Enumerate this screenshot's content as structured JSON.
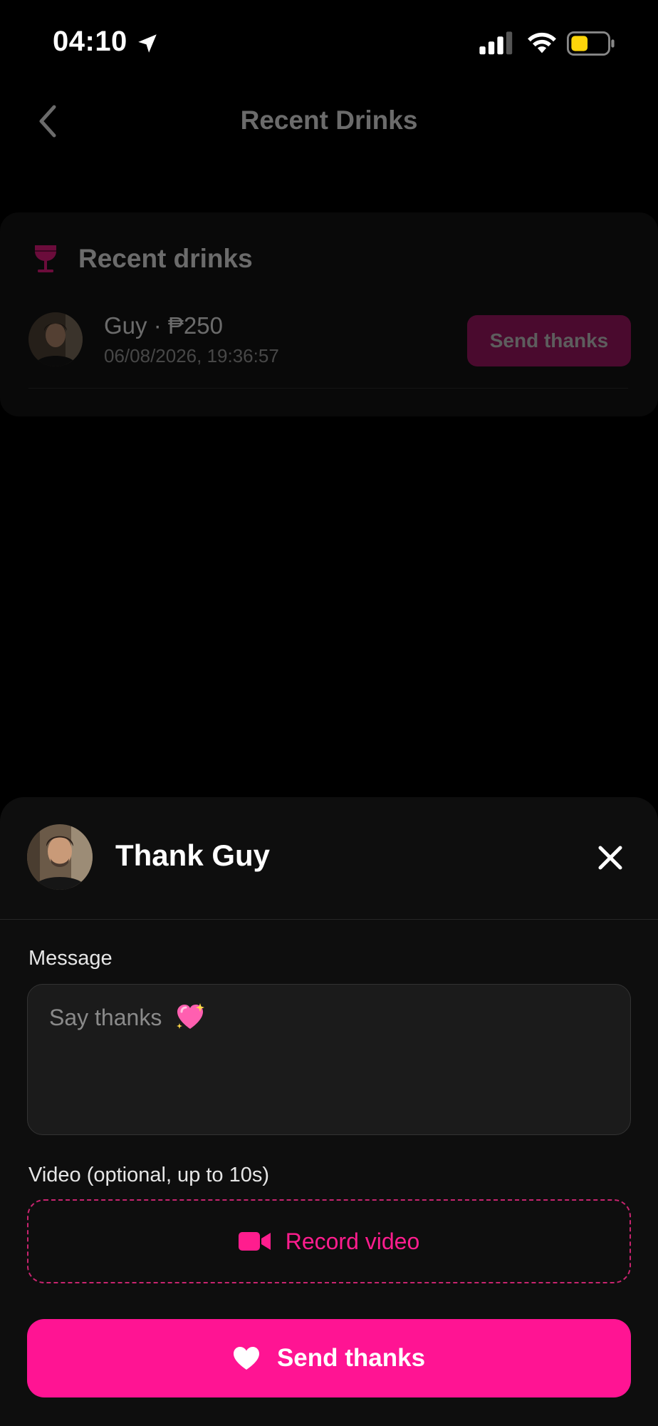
{
  "status_bar": {
    "time": "04:10",
    "icons": [
      "location-arrow-icon",
      "cellular-signal-icon",
      "wifi-icon",
      "battery-icon"
    ],
    "battery_color": "#FFD60A"
  },
  "nav": {
    "title": "Recent Drinks",
    "back_icon": "chevron-left-icon"
  },
  "recent_card": {
    "title": "Recent drinks",
    "icon": "wine-glass-icon",
    "items": [
      {
        "name_amount": "Guy · ₱250",
        "timestamp": "06/08/2026, 19:36:57",
        "button_label": "Send thanks"
      }
    ]
  },
  "sheet": {
    "title": "Thank Guy",
    "close_icon": "close-icon",
    "message_label": "Message",
    "message_placeholder": "Say thanks",
    "message_value": "",
    "video_label": "Video (optional, up to 10s)",
    "record_label": "Record video",
    "send_label": "Send thanks"
  },
  "colors": {
    "accent": "#FF1493",
    "background": "#000000",
    "sheet_bg": "#0E0E0E"
  }
}
